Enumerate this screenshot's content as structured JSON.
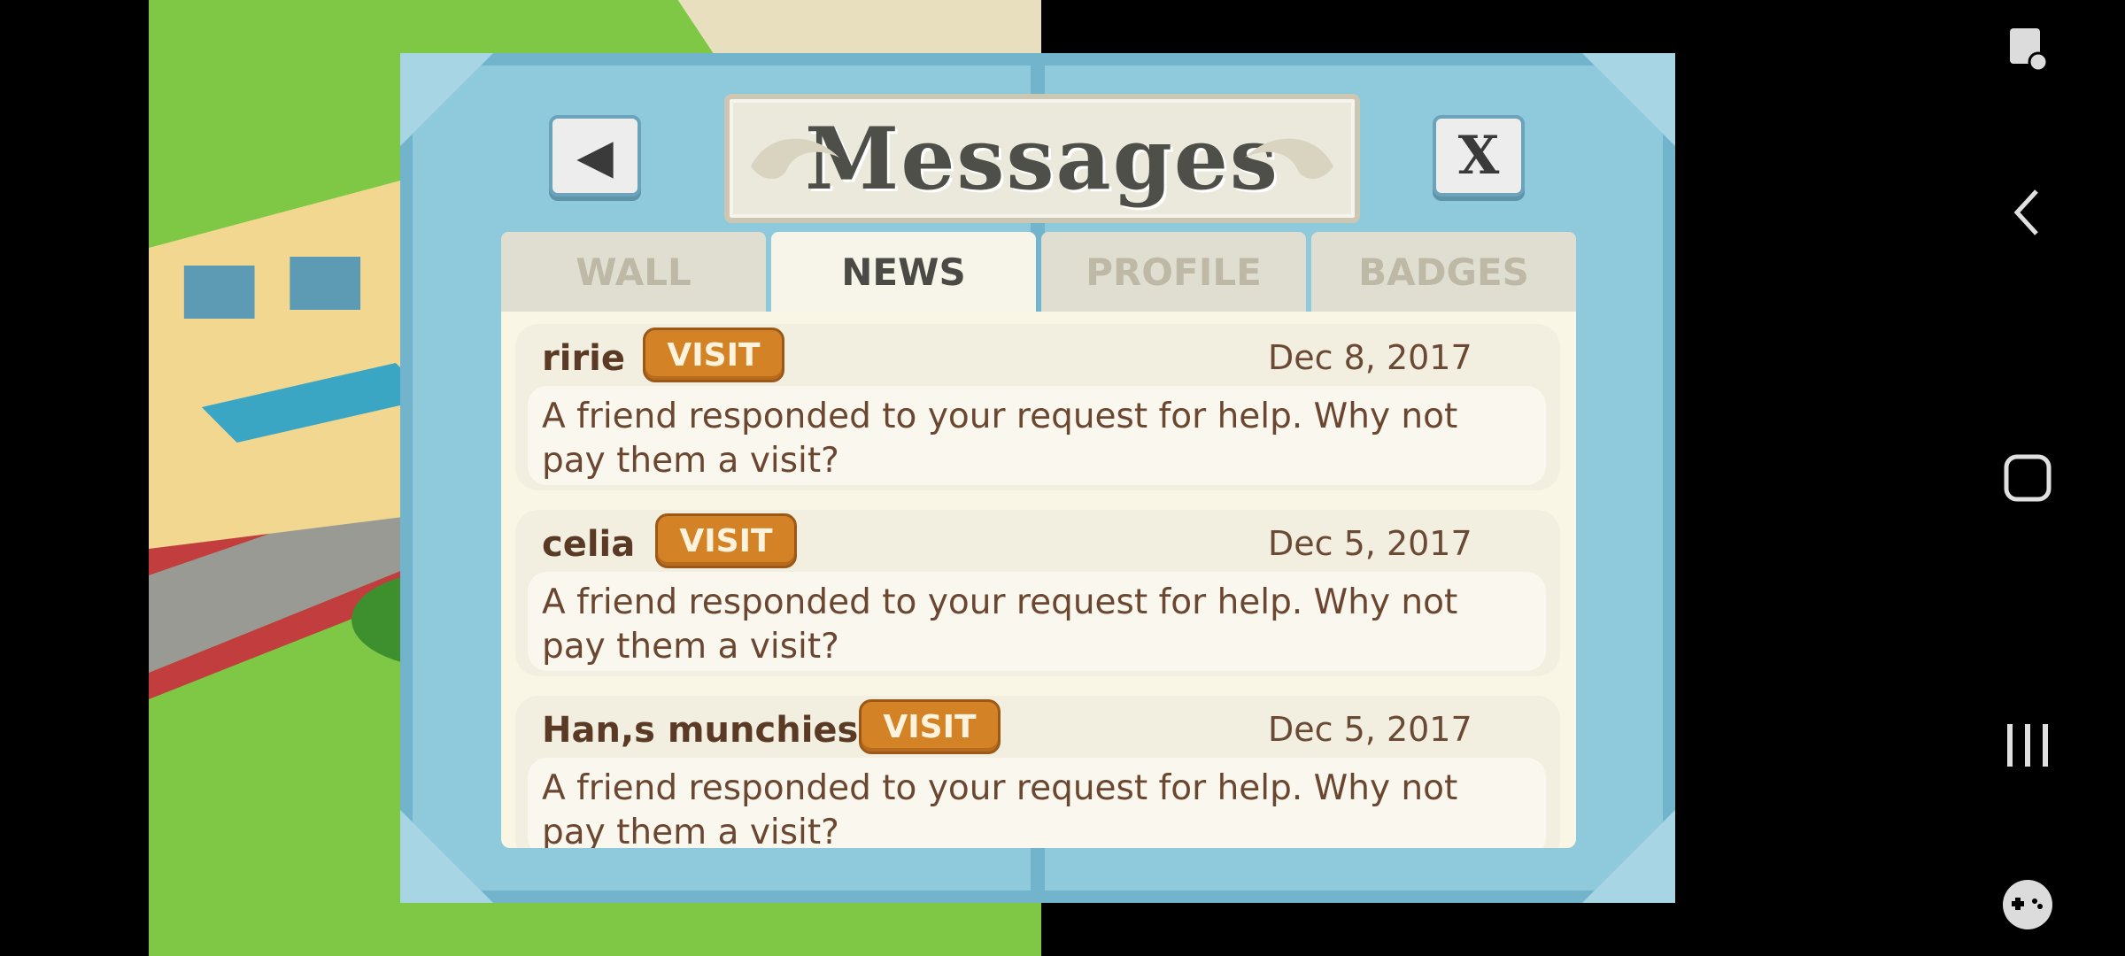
{
  "dialog": {
    "title": "Messages",
    "back_label": "◀",
    "close_label": "X"
  },
  "tabs": [
    {
      "label": "WALL",
      "active": false
    },
    {
      "label": "NEWS",
      "active": true
    },
    {
      "label": "PROFILE",
      "active": false
    },
    {
      "label": "BADGES",
      "active": false
    }
  ],
  "messages": [
    {
      "name": "ririe",
      "action": "VISIT",
      "date": "Dec 8, 2017",
      "text": "A friend responded to your request for help. Why not pay them a visit?"
    },
    {
      "name": "celia",
      "action": "VISIT",
      "date": "Dec 5, 2017",
      "text": "A friend responded to your request for help. Why not pay them a visit?"
    },
    {
      "name": "Han,s munchies",
      "action": "VISIT",
      "date": "Dec 5, 2017",
      "text": "A friend responded to your request for help. Why not pay them a visit?"
    }
  ],
  "system_nav": {
    "icons": [
      "screenshot-edit-icon",
      "back-icon",
      "home-icon",
      "recents-icon",
      "game-launcher-icon"
    ]
  },
  "colors": {
    "frame": "#8ec9dc",
    "panel": "#faf6e6",
    "visit_button": "#d48226",
    "grass": "#7ec846"
  }
}
